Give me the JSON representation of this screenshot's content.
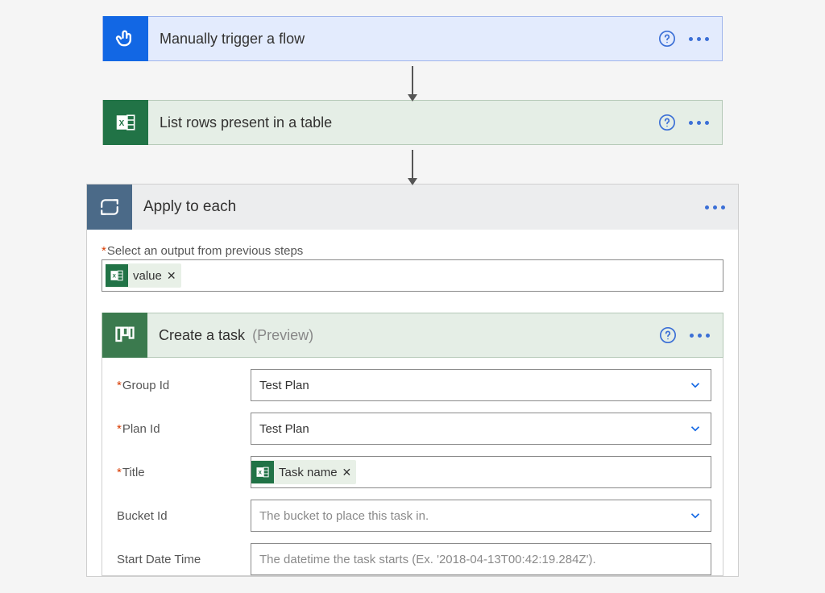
{
  "steps": {
    "trigger": {
      "title": "Manually trigger a flow"
    },
    "excel": {
      "title": "List rows present in a table"
    }
  },
  "apply": {
    "title": "Apply to each",
    "select_label": "Select an output from previous steps",
    "token": {
      "label": "value"
    }
  },
  "task": {
    "title": "Create a task",
    "tag": "(Preview)",
    "fields": {
      "group_id": {
        "label": "Group Id",
        "value": "Test Plan"
      },
      "plan_id": {
        "label": "Plan Id",
        "value": "Test Plan"
      },
      "title": {
        "label": "Title",
        "token": "Task name"
      },
      "bucket_id": {
        "label": "Bucket Id",
        "placeholder": "The bucket to place this task in."
      },
      "start": {
        "label": "Start Date Time",
        "placeholder": "The datetime the task starts (Ex. '2018-04-13T00:42:19.284Z')."
      }
    }
  }
}
